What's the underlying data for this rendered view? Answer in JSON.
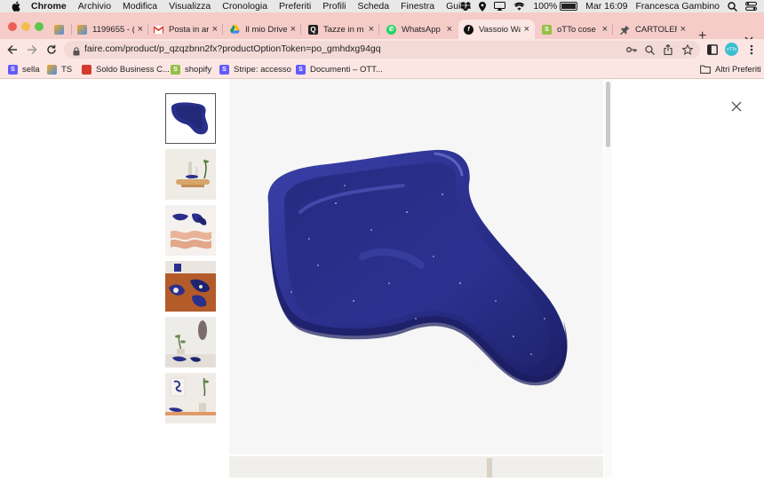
{
  "menubar": {
    "app_name": "Chrome",
    "items": [
      "Archivio",
      "Modifica",
      "Visualizza",
      "Cronologia",
      "Preferiti",
      "Profili",
      "Scheda",
      "Finestra",
      "Guida"
    ],
    "battery_percent": "100%",
    "battery_level": 1.0,
    "datetime": "Mar 16:09",
    "user": "Francesca Gambino"
  },
  "tabs": [
    {
      "title": "",
      "icon": "colorful-u-icon",
      "active": false
    },
    {
      "title": "1199655 - (",
      "icon": "colorful-u-icon",
      "active": false
    },
    {
      "title": "Posta in arr",
      "icon": "gmail-icon",
      "active": false
    },
    {
      "title": "Il mio Drive",
      "icon": "drive-icon",
      "active": false
    },
    {
      "title": "Tazze in m",
      "icon": "search-q-icon",
      "active": false
    },
    {
      "title": "WhatsApp",
      "icon": "whatsapp-icon",
      "active": false
    },
    {
      "title": "Vassoio Wa",
      "icon": "faire-icon",
      "active": true
    },
    {
      "title": "oTTo cose",
      "icon": "shopify-icon",
      "active": false
    },
    {
      "title": "CARTOLER",
      "icon": "pin-icon",
      "active": false
    }
  ],
  "toolbar": {
    "url": "faire.com/product/p_qzqzbnn2fx?productOptionToken=po_gmhdxg94gq",
    "profile_label": "oTTo"
  },
  "bookmarks": {
    "items": [
      {
        "label": "sella",
        "icon": "stripe-s-icon",
        "color": "#635bff"
      },
      {
        "label": "TS",
        "icon": "colorful-u-icon",
        "color": "#4a7ee0"
      },
      {
        "label": "Soldo Business C...",
        "icon": "soldo-icon",
        "color": "#d33b2c"
      },
      {
        "label": "shopify",
        "icon": "shopify-icon",
        "color": "#95bf47"
      },
      {
        "label": "Stripe: accesso",
        "icon": "stripe-s-icon",
        "color": "#635bff"
      },
      {
        "label": "Documenti – OTT...",
        "icon": "stripe-s-icon",
        "color": "#635bff"
      }
    ],
    "other_label": "Altri Preferiti"
  },
  "colors": {
    "tab_strip": "#f5ccc8",
    "toolbar": "#fbe6e3",
    "tray_blue": "#2a2f8c"
  },
  "gallery": {
    "thumbnail_count": 6,
    "selected_index": 0
  }
}
